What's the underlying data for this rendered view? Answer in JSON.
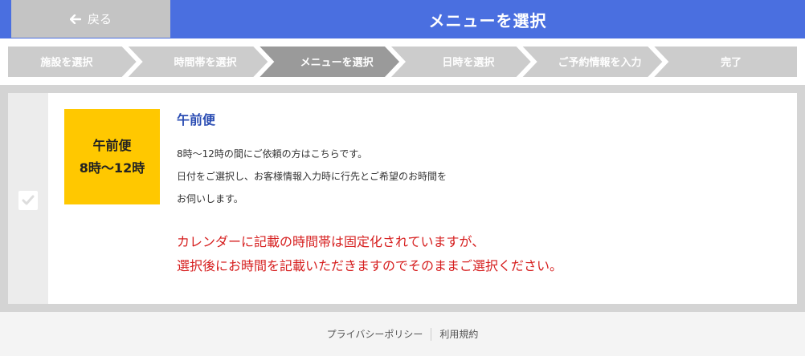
{
  "header": {
    "back_label": "戻る",
    "title": "メニューを選択"
  },
  "steps": [
    {
      "label": "施設を選択",
      "active": false
    },
    {
      "label": "時間帯を選択",
      "active": false
    },
    {
      "label": "メニューを選択",
      "active": true
    },
    {
      "label": "日時を選択",
      "active": false
    },
    {
      "label": "ご予約情報を入力",
      "active": false
    },
    {
      "label": "完了",
      "active": false
    }
  ],
  "colors": {
    "header_bg": "#4a6fe0",
    "step_inactive": "#cccccc",
    "step_active": "#9a9a9a",
    "tile_bg": "#ffc800",
    "title_blue": "#2b4db3",
    "notice_red": "#d61e1e"
  },
  "menu_item": {
    "tile_line1": "午前便",
    "tile_line2": "8時～12時",
    "title": "午前便",
    "desc": [
      "8時～12時の間にご依頼の方はこちらです。",
      "日付をご選択し、お客様情報入力時に行先とご希望のお時間を",
      "お伺いします。"
    ],
    "notice": [
      "カレンダーに記載の時間帯は固定化されていますが、",
      "選択後にお時間を記載いただきますのでそのままご選択ください。"
    ],
    "check_icon": "check-icon"
  },
  "footer": {
    "privacy": "プライバシーポリシー",
    "terms": "利用規約"
  }
}
